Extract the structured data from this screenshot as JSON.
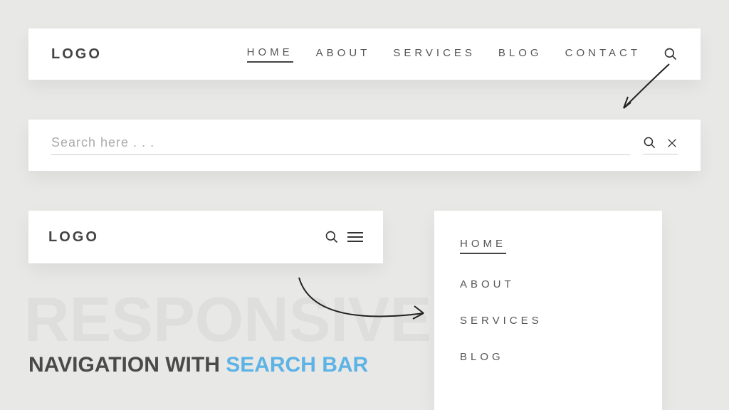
{
  "logo": "LOGO",
  "nav": {
    "items": [
      "HOME",
      "ABOUT",
      "SERVICES",
      "BLOG",
      "CONTACT"
    ],
    "active": "HOME"
  },
  "search": {
    "placeholder": "Search here . . ."
  },
  "dropdown": {
    "items": [
      "HOME",
      "ABOUT",
      "SERVICES",
      "BLOG"
    ],
    "active": "HOME"
  },
  "hero": {
    "bg": "RESPONSIVE",
    "line1": "NAVIGATION WITH ",
    "accent": "SEARCH BAR"
  }
}
